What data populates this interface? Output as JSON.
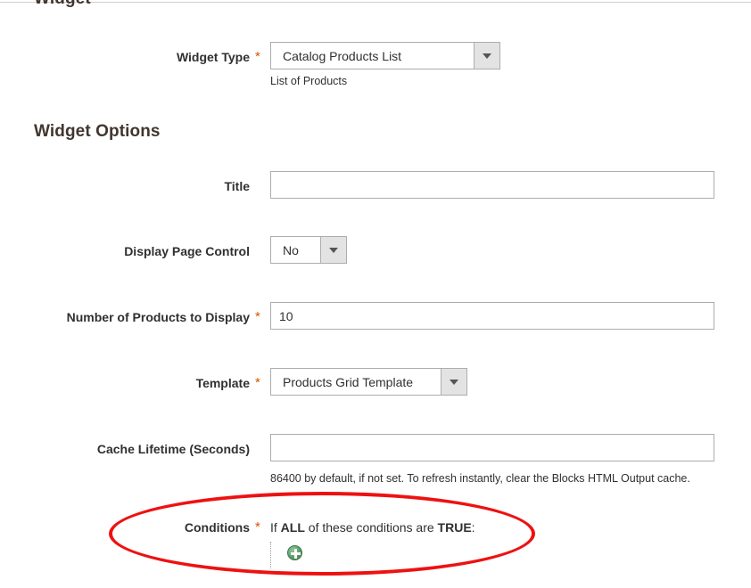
{
  "page": {
    "section_widget_title": "Widget",
    "section_options_title": "Widget Options"
  },
  "widget_type": {
    "label": "Widget Type",
    "required_mark": "*",
    "value": "Catalog Products List",
    "note": "List of Products"
  },
  "title_field": {
    "label": "Title",
    "value": "",
    "placeholder": ""
  },
  "display_page_control": {
    "label": "Display Page Control",
    "value": "No"
  },
  "number_of_products": {
    "label": "Number of Products to Display",
    "required_mark": "*",
    "value": "10"
  },
  "template": {
    "label": "Template",
    "required_mark": "*",
    "value": "Products Grid Template"
  },
  "cache_lifetime": {
    "label": "Cache Lifetime (Seconds)",
    "value": "",
    "placeholder": "",
    "note": "86400 by default, if not set. To refresh instantly, clear the Blocks HTML Output cache."
  },
  "conditions": {
    "label": "Conditions",
    "required_mark": "*",
    "prefix": "If",
    "aggregator": "ALL",
    "middle": "of these conditions are",
    "value_true": "TRUE",
    "suffix": ":",
    "add_icon": "plus-circle-icon"
  },
  "colors": {
    "required_asterisk": "#e04f00",
    "heading": "#41362f",
    "annotation": "#ee1111",
    "input_border": "#adadad",
    "select_button_bg": "#e3e3e3",
    "add_button_green": "#5d9e6d"
  }
}
